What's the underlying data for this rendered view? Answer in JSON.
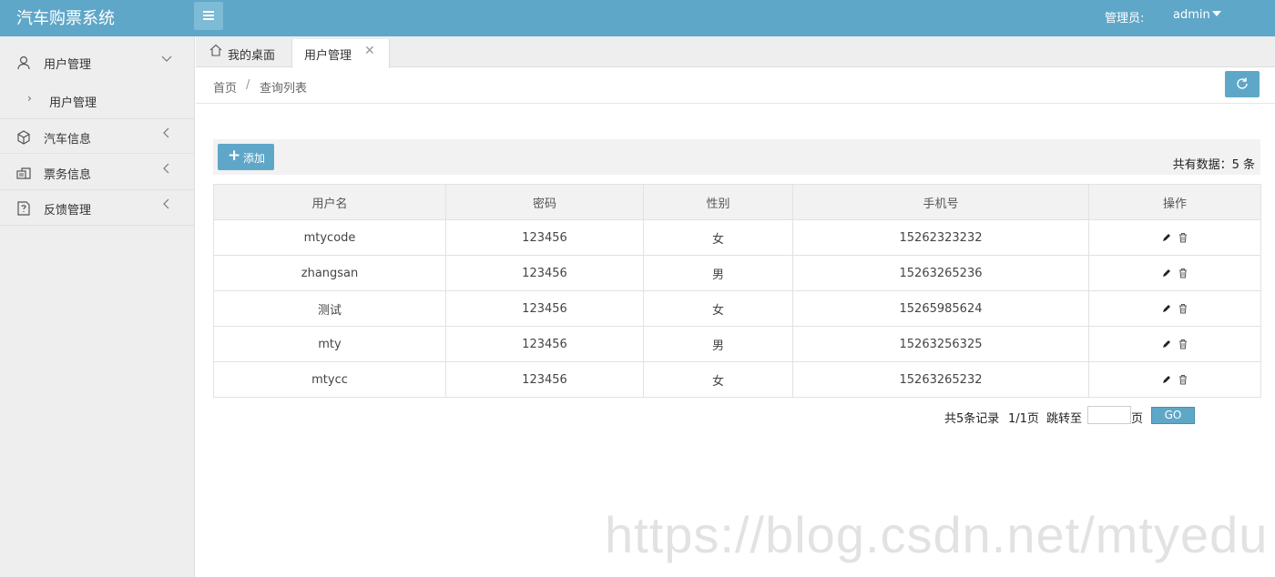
{
  "app": {
    "title": "汽车购票系统",
    "admin_label": "管理员:",
    "admin_name": "admin"
  },
  "sidebar": {
    "items": [
      {
        "label": "用户管理",
        "icon": "user-icon"
      },
      {
        "label": "汽车信息",
        "icon": "cube-icon"
      },
      {
        "label": "票务信息",
        "icon": "ticket-icon"
      },
      {
        "label": "反馈管理",
        "icon": "feedback-icon"
      }
    ],
    "sub_items": [
      {
        "label": "用户管理"
      }
    ]
  },
  "tabs": [
    {
      "label": "我的桌面",
      "icon": "home-icon"
    },
    {
      "label": "用户管理",
      "active": true
    }
  ],
  "breadcrumb": {
    "home": "首页",
    "separator": "/",
    "current": "查询列表"
  },
  "toolbar": {
    "add_label": "添加",
    "total_text": "共有数据：5 条"
  },
  "table": {
    "columns": [
      "用户名",
      "密码",
      "性别",
      "手机号",
      "操作"
    ],
    "rows": [
      [
        "mtycode",
        "123456",
        "女",
        "15262323232"
      ],
      [
        "zhangsan",
        "123456",
        "男",
        "15263265236"
      ],
      [
        "测试",
        "123456",
        "女",
        "15265985624"
      ],
      [
        "mty",
        "123456",
        "男",
        "15263256325"
      ],
      [
        "mtycc",
        "123456",
        "女",
        "15263265232"
      ]
    ]
  },
  "pager": {
    "records": "共5条记录",
    "pages": "1/1页",
    "jump_label": "跳转至",
    "page_suffix": "页",
    "go_label": "GO",
    "input_value": ""
  },
  "watermark": "https://blog.csdn.net/mtyedu",
  "colors": {
    "accent": "#5fa7c8",
    "sidebar_bg": "#eeeeee"
  }
}
